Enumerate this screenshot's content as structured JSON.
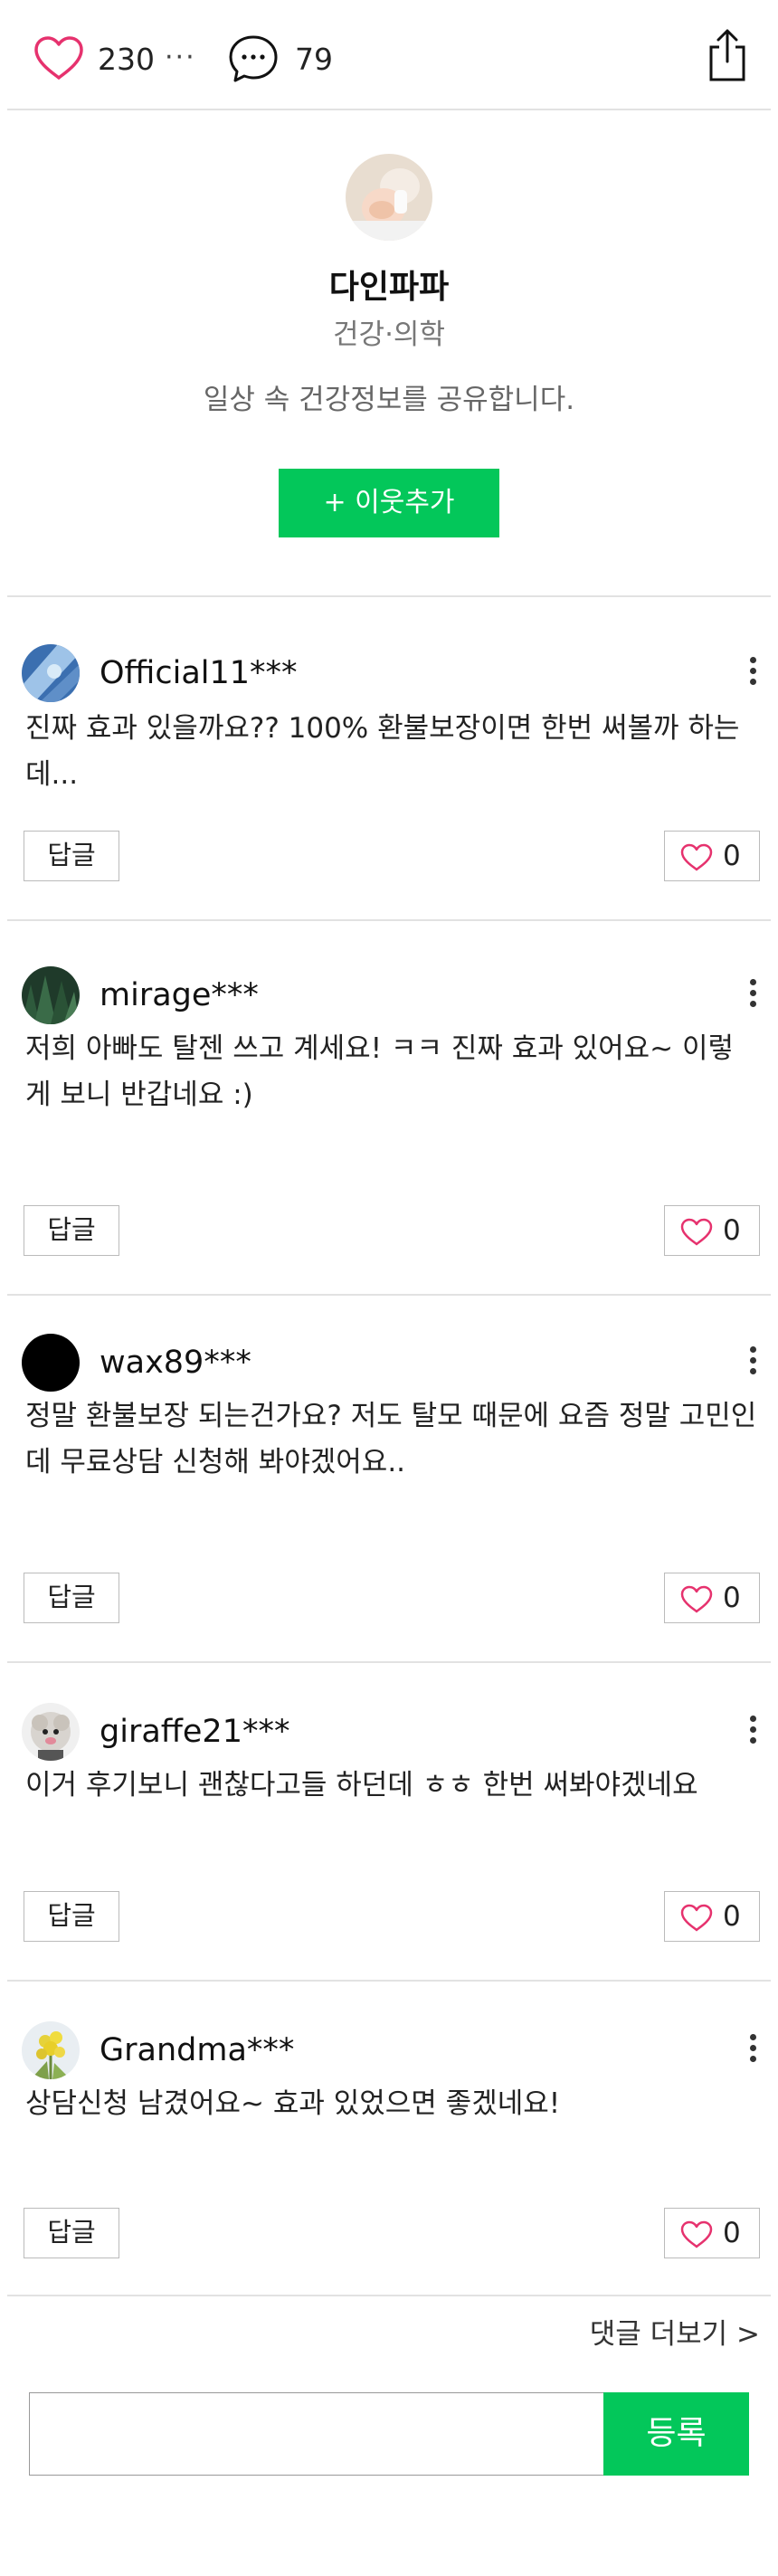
{
  "header": {
    "like_count": "230",
    "more": "···",
    "comment_count": "79"
  },
  "profile": {
    "name": "다인파파",
    "category": "건강·의학",
    "description": "일상 속 건강정보를 공유합니다.",
    "add_button": "+ 이웃추가"
  },
  "comments": [
    {
      "user": "Official11***",
      "text": "진짜 효과 있을까요?? 100% 환불보장이면 한번 써볼까 하는데...",
      "reply": "답글",
      "likes": "0"
    },
    {
      "user": "mirage***",
      "text": "저희 아빠도 탈젠 쓰고 계세요! ㅋㅋ 진짜 효과 있어요~ 이렇게 보니 반갑네요 :)",
      "reply": "답글",
      "likes": "0"
    },
    {
      "user": "wax89***",
      "text": "정말 환불보장 되는건가요? 저도 탈모 때문에 요즘 정말 고민인데 무료상담 신청해 봐야겠어요..",
      "reply": "답글",
      "likes": "0"
    },
    {
      "user": "giraffe21***",
      "text": "이거 후기보니 괜찮다고들 하던데 ㅎㅎ 한번 써봐야겠네요",
      "reply": "답글",
      "likes": "0"
    },
    {
      "user": "Grandma***",
      "text": "상담신청 남겼어요~ 효과 있었으면 좋겠네요!",
      "reply": "답글",
      "likes": "0"
    }
  ],
  "footer": {
    "more_comments": "댓글 더보기 >",
    "input_value": "",
    "submit": "등록"
  },
  "colors": {
    "accent_green": "#03c75a",
    "heart_pink": "#e6326e"
  }
}
